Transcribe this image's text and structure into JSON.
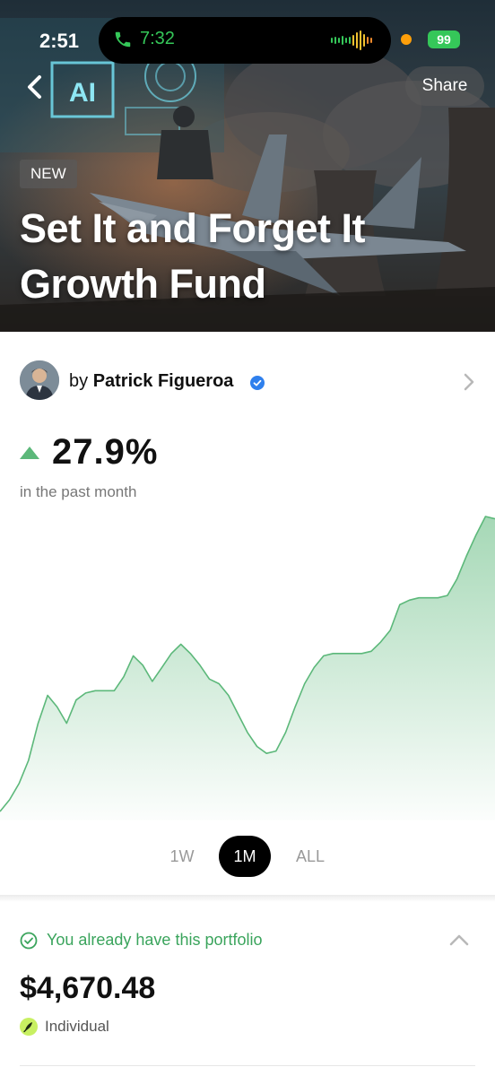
{
  "status_bar": {
    "time": "2:51",
    "call_duration": "7:32",
    "battery": "99"
  },
  "hero": {
    "share_label": "Share",
    "badge": "NEW",
    "title": "Set It and Forget It Growth Fund",
    "image_text": "AI"
  },
  "author": {
    "prefix": "by",
    "name": "Patrick Figueroa"
  },
  "performance": {
    "change": "27.9%",
    "direction": "up",
    "period": "in the past month"
  },
  "chart_data": {
    "type": "area",
    "y": [
      0,
      5,
      12,
      22,
      38,
      50,
      45,
      38,
      48,
      51,
      52,
      52,
      52,
      58,
      67,
      63,
      56,
      62,
      68,
      72,
      68,
      63,
      57,
      55,
      50,
      42,
      34,
      28,
      25,
      26,
      34,
      45,
      55,
      62,
      67,
      68,
      68,
      68,
      68,
      69,
      73,
      78,
      89,
      91,
      92,
      92,
      92,
      93,
      100,
      110,
      119,
      127,
      126
    ],
    "color": "#5cb87a"
  },
  "range_tabs": {
    "items": [
      {
        "label": "1W"
      },
      {
        "label": "1M"
      },
      {
        "label": "ALL"
      }
    ],
    "selected": "1M"
  },
  "holdings": {
    "owned_text": "You already have this portfolio",
    "balance": "$4,670.48",
    "account_type": "Individual"
  },
  "colors": {
    "accent_green": "#3aa45c",
    "chart_green": "#5cb87a",
    "verified_blue": "#2f80ed"
  }
}
